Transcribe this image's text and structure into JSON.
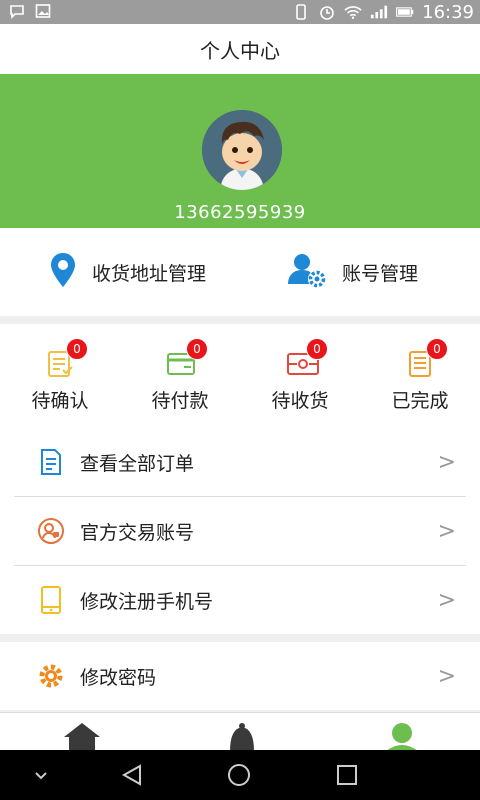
{
  "status_bar": {
    "time": "16:39",
    "colors": {
      "bg": "#9c9c9c",
      "fg": "#ffffff"
    }
  },
  "header": {
    "title": "个人中心"
  },
  "profile": {
    "phone": "13662595939",
    "colors": {
      "hero_bg": "#6dbd4f"
    }
  },
  "quick_links": [
    {
      "label": "收货地址管理",
      "icon": "location-pin-icon"
    },
    {
      "label": "账号管理",
      "icon": "account-settings-icon"
    }
  ],
  "orders": [
    {
      "label": "待确认",
      "count": "0",
      "icon": "pending-confirm-icon"
    },
    {
      "label": "待付款",
      "count": "0",
      "icon": "pending-payment-icon"
    },
    {
      "label": "待收货",
      "count": "0",
      "icon": "pending-receive-icon"
    },
    {
      "label": "已完成",
      "count": "0",
      "icon": "completed-icon"
    }
  ],
  "menu": [
    {
      "label": "查看全部订单",
      "icon": "order-list-icon",
      "arrow": ">"
    },
    {
      "label": "官方交易账号",
      "icon": "official-account-icon",
      "arrow": ">"
    },
    {
      "label": "修改注册手机号",
      "icon": "mobile-phone-icon",
      "arrow": ">"
    },
    {
      "label": "修改密码",
      "icon": "gear-icon",
      "arrow": ">"
    }
  ],
  "tab_bar": [
    {
      "icon": "home-icon",
      "active": false
    },
    {
      "icon": "bell-icon",
      "active": false
    },
    {
      "icon": "user-icon",
      "active": true
    }
  ],
  "colors": {
    "accent": "#6dbd4f",
    "badge": "#e8151b",
    "blue": "#1e88d6"
  }
}
